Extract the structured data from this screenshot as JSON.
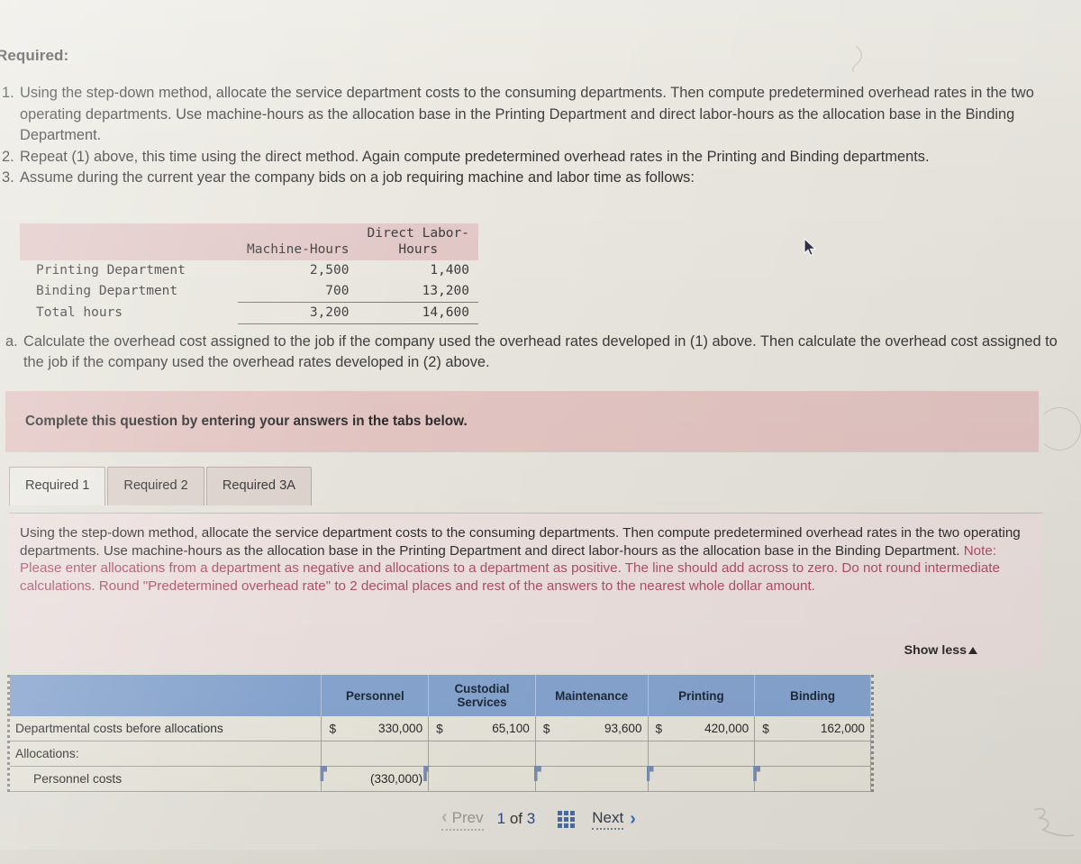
{
  "header": {
    "required_label": "Required:"
  },
  "instructions": [
    {
      "num": "1.",
      "text": "Using the step-down method, allocate the service department costs to the consuming departments. Then compute predetermined overhead rates in the two operating departments. Use machine-hours as the allocation base in the Printing Department and direct labor-hours as the allocation base in the Binding Department."
    },
    {
      "num": "2.",
      "text": "Repeat (1) above, this time using the direct method. Again compute predetermined overhead rates in the Printing and Binding departments."
    },
    {
      "num": "3.",
      "text": "Assume during the current year the company bids on a job requiring machine and labor time as follows:"
    }
  ],
  "hours_table": {
    "columns": [
      "",
      "Machine-Hours",
      "Direct Labor-Hours"
    ],
    "col_headers": {
      "machine_hours": "Machine-Hours",
      "direct_labor_hours_line1": "Direct Labor-",
      "direct_labor_hours_line2": "Hours"
    },
    "rows": [
      {
        "label": "Printing Department",
        "machine_hours": "2,500",
        "direct_labor_hours": "1,400"
      },
      {
        "label": "Binding Department",
        "machine_hours": "700",
        "direct_labor_hours": "13,200"
      },
      {
        "label": "Total hours",
        "machine_hours": "3,200",
        "direct_labor_hours": "14,600"
      }
    ]
  },
  "part_a": {
    "num": "a.",
    "text": "Calculate the overhead cost assigned to the job if the company used the overhead rates developed in (1) above. Then calculate the overhead cost assigned to the job if the company used the overhead rates developed in (2) above."
  },
  "banner": {
    "text": "Complete this question by entering your answers in the tabs below."
  },
  "tabs": [
    {
      "label": "Required 1",
      "active": true
    },
    {
      "label": "Required 2",
      "active": false
    },
    {
      "label": "Required 3A",
      "active": false
    }
  ],
  "panel": {
    "paragraph": "Using the step-down method, allocate the service department costs to the consuming departments. Then compute predetermined overhead rates in the two operating departments. Use machine-hours as the allocation base in the Printing Department and direct labor-hours as the allocation base in the Binding Department.",
    "note": "Note: Please enter allocations from a department as negative and allocations to a department as positive. The line should add across to zero. Do not round intermediate calculations. Round \"Predetermined overhead rate\" to 2 decimal places and rest of the answers to the nearest whole dollar amount.",
    "show_less_label": "Show less"
  },
  "answer_grid": {
    "columns": [
      {
        "key": "label",
        "label": ""
      },
      {
        "key": "personnel",
        "label": "Personnel"
      },
      {
        "key": "custodial",
        "label": "Custodial Services"
      },
      {
        "key": "maintenance",
        "label": "Maintenance"
      },
      {
        "key": "printing",
        "label": "Printing"
      },
      {
        "key": "binding",
        "label": "Binding"
      }
    ],
    "rows": [
      {
        "type": "values",
        "label": "Departmental costs before allocations",
        "personnel": {
          "currency": "$",
          "value": "330,000"
        },
        "custodial": {
          "currency": "$",
          "value": "65,100"
        },
        "maintenance": {
          "currency": "$",
          "value": "93,600"
        },
        "printing": {
          "currency": "$",
          "value": "420,000"
        },
        "binding": {
          "currency": "$",
          "value": "162,000"
        }
      },
      {
        "type": "section",
        "label": "Allocations:",
        "personnel": {
          "currency": "",
          "value": ""
        },
        "custodial": {
          "currency": "",
          "value": ""
        },
        "maintenance": {
          "currency": "",
          "value": ""
        },
        "printing": {
          "currency": "",
          "value": ""
        },
        "binding": {
          "currency": "",
          "value": ""
        }
      },
      {
        "type": "inputs",
        "label": "Personnel costs",
        "personnel": {
          "currency": "",
          "value": "(330,000)"
        },
        "custodial": {
          "currency": "",
          "value": ""
        },
        "maintenance": {
          "currency": "",
          "value": ""
        },
        "printing": {
          "currency": "",
          "value": ""
        },
        "binding": {
          "currency": "",
          "value": ""
        }
      }
    ]
  },
  "pager": {
    "prev_label": "Prev",
    "next_label": "Next",
    "current_page": "1",
    "of_label": "of",
    "total_pages": "3",
    "grid_icon": "grid-3x3-icon"
  },
  "colors": {
    "page_background": "#e9e7df",
    "banner_pink": "#e5c7c4",
    "panel_pink": "#f0e4e2",
    "note_red": "#b0506a",
    "grid_header_blue": "#89a8d4",
    "next_chevron_blue": "#3f6fbe",
    "tab_active_bg": "#efeee8",
    "tab_inactive_bg": "#e0d5cf"
  }
}
